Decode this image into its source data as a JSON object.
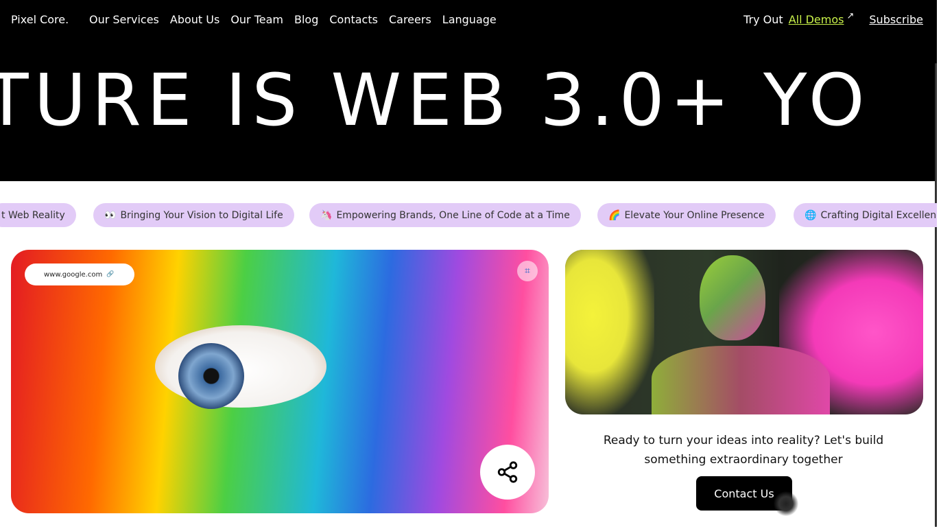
{
  "nav": {
    "brand": "Pixel Core.",
    "items": [
      "Our Services",
      "About Us",
      "Our Team",
      "Blog",
      "Contacts",
      "Careers",
      "Language"
    ],
    "try_out": "Try Out",
    "all_demos": "All Demos",
    "subscribe": "Subscribe"
  },
  "hero": {
    "title": "TURE IS WEB 3.0+ YO"
  },
  "tags": [
    {
      "emoji": "",
      "label": "t Web Reality"
    },
    {
      "emoji": "👀",
      "label": "Bringing Your Vision to Digital Life"
    },
    {
      "emoji": "🦄",
      "label": "Empowering Brands, One Line of Code at a Time"
    },
    {
      "emoji": "🌈",
      "label": "Elevate Your Online Presence"
    },
    {
      "emoji": "🌐",
      "label": "Crafting Digital Excellence"
    }
  ],
  "featured": {
    "url": "www.google.com"
  },
  "cta": {
    "text": "Ready to turn your ideas into reality?   Let's build something extraordinary together",
    "button": "Contact Us"
  },
  "colors": {
    "accent": "#c8f04a",
    "tag_bg": "#e2cbf7",
    "header_bg": "#000000"
  }
}
